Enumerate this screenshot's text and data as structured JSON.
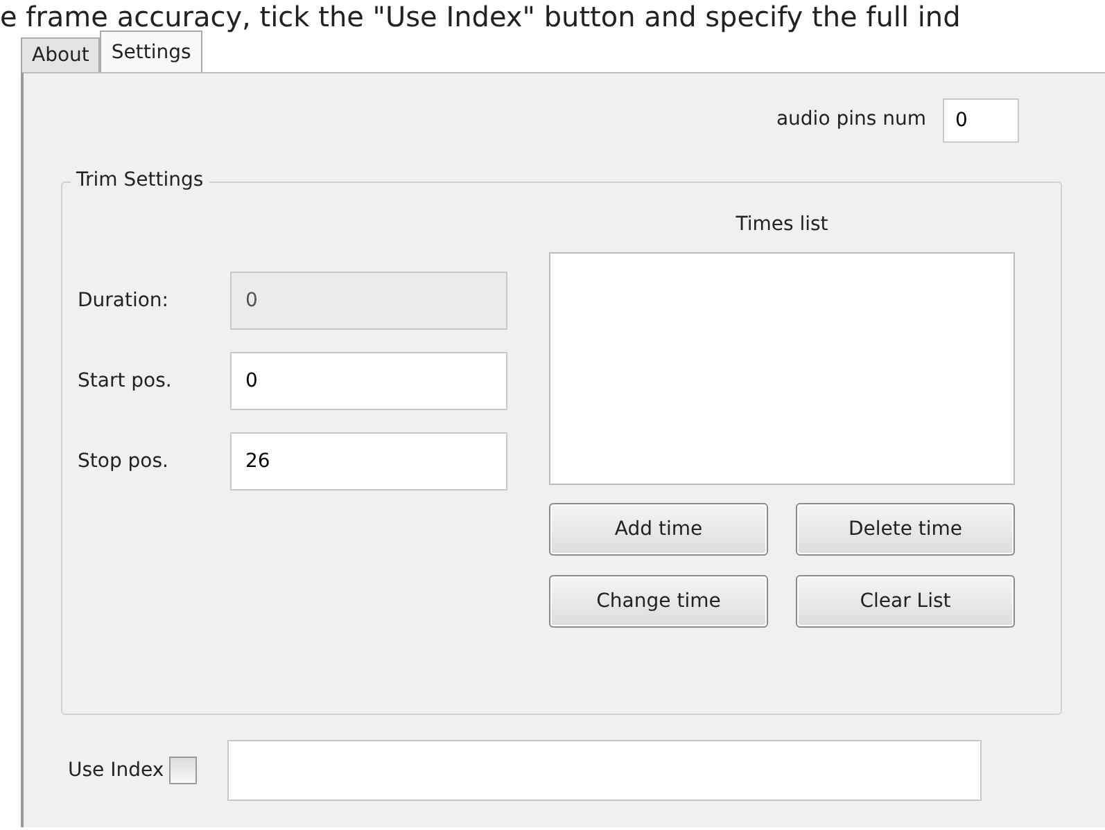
{
  "caption": "e frame accuracy, tick the \"Use Index\" button and specify the full ind",
  "tabs": [
    {
      "label": "About",
      "selected": false
    },
    {
      "label": "Settings",
      "selected": true
    }
  ],
  "audio_pins": {
    "label": "audio pins num",
    "value": "0"
  },
  "trim_settings": {
    "title": "Trim Settings",
    "fields": [
      {
        "label": "Duration:",
        "value": "0",
        "disabled": true
      },
      {
        "label": "Start pos.",
        "value": "0",
        "disabled": false
      },
      {
        "label": "Stop pos.",
        "value": "26",
        "disabled": false
      }
    ],
    "times_list": {
      "label": "Times list"
    },
    "buttons": [
      "Add time",
      "Delete time",
      "Change time",
      "Clear List"
    ]
  },
  "use_index": {
    "label": "Use Index",
    "checked": false
  }
}
